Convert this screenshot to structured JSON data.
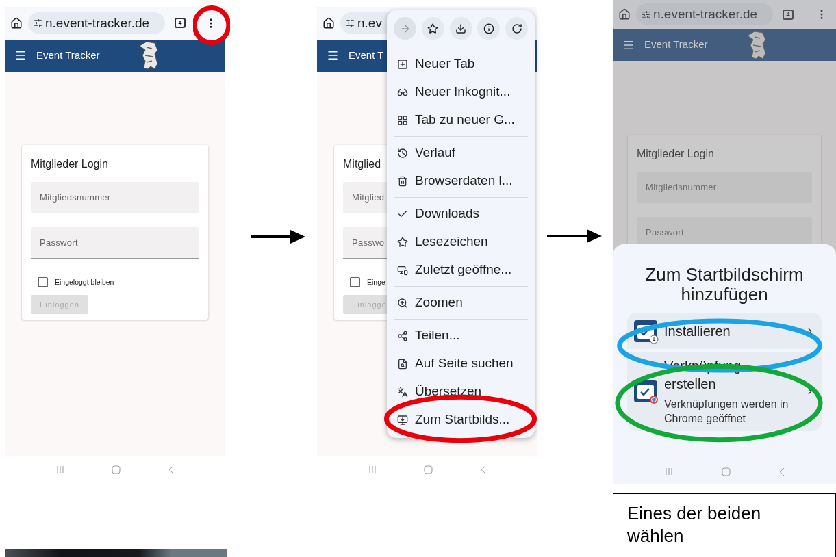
{
  "screen_1": {
    "url": "n.event-tracker.de",
    "tab_count": "4",
    "app_title": "Event Tracker",
    "card_title": "Mitglieder Login",
    "fields": [
      "Mitgliedsnummer",
      "Passwort"
    ],
    "remember": {
      "label": "Eingeloggt bleiben",
      "checked": false
    },
    "login_button": {
      "label": "Einloggen",
      "disabled": true
    },
    "highlight": {
      "color": "#e8000b"
    }
  },
  "screen_2": {
    "url": "n.ev",
    "app_title": "Event T",
    "card_title": "Mitglied",
    "fields": [
      "Mitglied",
      "Passwo"
    ],
    "remember": {
      "label": "Einge",
      "checked": false
    },
    "login_button": {
      "label": "Einlogge",
      "disabled": true
    },
    "menu": {
      "toolbar": [
        {
          "disabled": true
        },
        {
          "disabled": false
        },
        {
          "disabled": false
        },
        {
          "disabled": false
        },
        {
          "disabled": false
        }
      ],
      "groups": [
        [
          "Neuer Tab",
          "Neuer Inkognit...",
          "Tab zu neuer G..."
        ],
        [
          "Verlauf",
          "Browserdaten l..."
        ],
        [
          "Downloads",
          "Lesezeichen",
          "Zuletzt geöffne..."
        ],
        [
          "Zoomen"
        ],
        [
          "Teilen...",
          "Auf Seite suchen",
          "Übersetzen",
          "Zum Startbilds..."
        ]
      ]
    },
    "highlight": {
      "color": "#e8000b"
    }
  },
  "screen_3": {
    "url": "n.event-tracker.de",
    "tab_count": "4",
    "app_title": "Event Tracker",
    "card_title": "Mitglieder Login",
    "fields": [
      "Mitgliedsnummer",
      "Passwort"
    ],
    "sheet": {
      "title": "Zum Startbildschirm hinzufügen",
      "options": [
        {
          "kind": "install",
          "title": "Installieren",
          "highlight": {
            "color": "#1ba3e3"
          }
        },
        {
          "kind": "shortcut",
          "title": "Verknüpfung erstellen",
          "subtitle": "Verknüpfungen werden in Chrome geöffnet",
          "highlight": {
            "color": "#14a83b"
          }
        }
      ]
    }
  },
  "note": "Eines der beiden wählen"
}
